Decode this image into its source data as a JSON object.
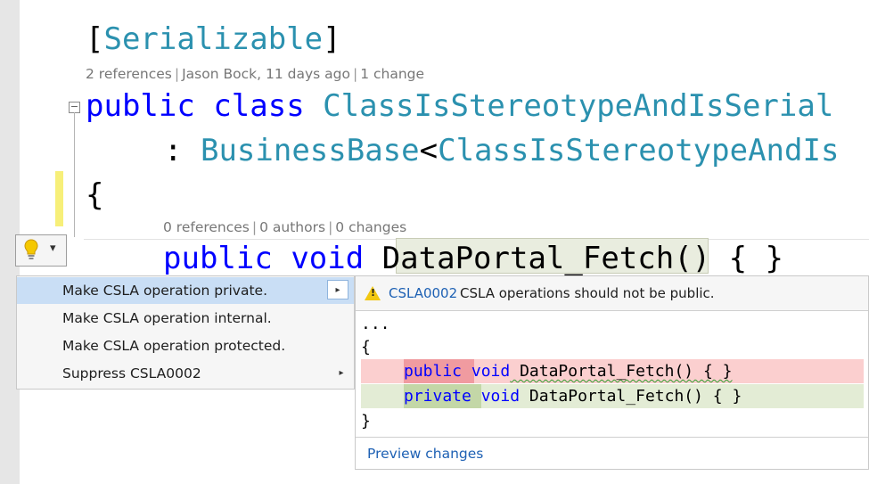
{
  "editor": {
    "attribute_line": {
      "open": "[",
      "name": "Serializable",
      "close": "]"
    },
    "class_lens": {
      "references": "2 references",
      "author": "Jason Bock, 11 days ago",
      "changes": "1 change"
    },
    "class_decl": {
      "kw1": "public",
      "kw2": "class",
      "name": "ClassIsStereotypeAndIsSerial"
    },
    "base_decl": {
      "colon": ":",
      "base": "BusinessBase",
      "lt": "<",
      "generic": "ClassIsStereotypeAndIs"
    },
    "open_brace": "{",
    "method_lens": {
      "references": "0 references",
      "authors": "0 authors",
      "changes": "0 changes"
    },
    "method_decl": {
      "kw1": "public",
      "kw2": "void",
      "name": "DataPortal_Fetch",
      "rest": "() { }"
    }
  },
  "lightbulb": {
    "icon": "lightbulb-icon",
    "chevron": "▾"
  },
  "quick_actions": {
    "items": [
      {
        "label": "Make CSLA operation private.",
        "selected": true,
        "has_submenu": true
      },
      {
        "label": "Make CSLA operation internal.",
        "selected": false,
        "has_submenu": false
      },
      {
        "label": "Make CSLA operation protected.",
        "selected": false,
        "has_submenu": false
      },
      {
        "label": "Suppress CSLA0002",
        "selected": false,
        "has_submenu": true
      }
    ],
    "submenu_arrow": "▸"
  },
  "preview": {
    "diagnostic_code": "CSLA0002",
    "diagnostic_message": "CSLA operations should not be public.",
    "lines": {
      "ellipsis": "...",
      "open_brace": "{",
      "removed": {
        "kw": "public",
        "kw2": "void",
        "rest": " DataPortal_Fetch() { }"
      },
      "added": {
        "kw": "private",
        "kw2": "void",
        "rest": " DataPortal_Fetch() { }"
      },
      "close_brace": "}"
    },
    "preview_link": "Preview changes"
  },
  "colors": {
    "keyword": "#0000ff",
    "type": "#2b91af",
    "lens_text": "#777777",
    "menu_selected": "#c9def5",
    "removed_line": "#fbcfcf",
    "added_line": "#e3ecd5",
    "link": "#1e61b4",
    "warning": "#f2c811"
  }
}
